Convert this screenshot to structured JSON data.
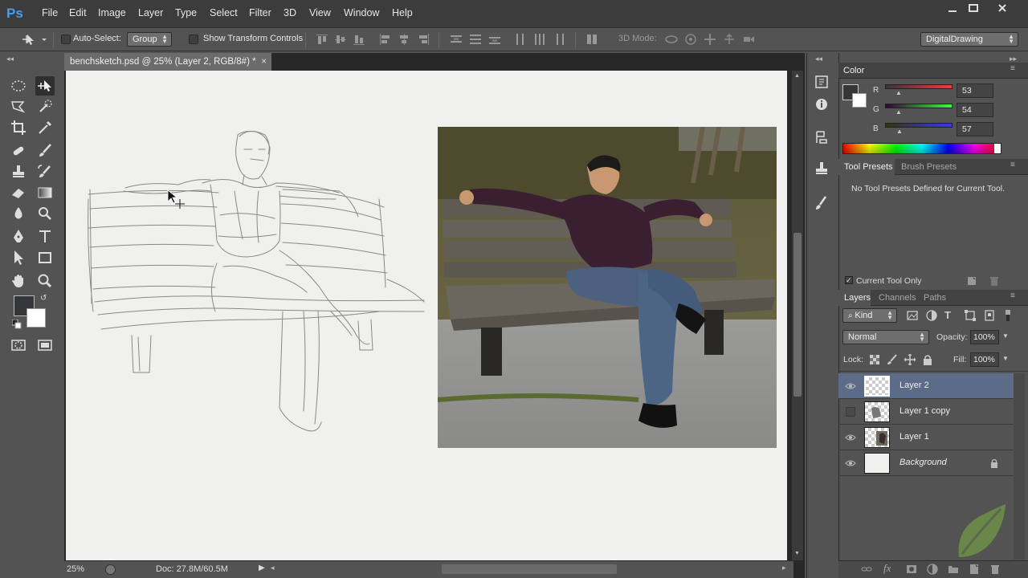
{
  "app": {
    "logo": "Ps"
  },
  "menu": [
    "File",
    "Edit",
    "Image",
    "Layer",
    "Type",
    "Select",
    "Filter",
    "3D",
    "View",
    "Window",
    "Help"
  ],
  "options": {
    "auto_select_label": "Auto-Select:",
    "auto_select_value": "Group",
    "show_transform_label": "Show Transform Controls",
    "mode3d_label": "3D Mode:",
    "workspace": "DigitalDrawing"
  },
  "document": {
    "tab_title": "benchsketch.psd @ 25% (Layer 2, RGB/8#) *",
    "tab_close": "×"
  },
  "status": {
    "zoom": "25%",
    "doc_size": "Doc: 27.8M/60.5M"
  },
  "color_panel": {
    "tab": "Color",
    "r_label": "R",
    "r_value": "53",
    "g_label": "G",
    "g_value": "54",
    "b_label": "B",
    "b_value": "57",
    "foreground_hex": "#353639"
  },
  "presets_panel": {
    "tab_tool_presets": "Tool Presets",
    "tab_brush_presets": "Brush Presets",
    "empty_message": "No Tool Presets Defined for Current Tool.",
    "current_tool_only": "Current Tool Only"
  },
  "layers_panel": {
    "tab_layers": "Layers",
    "tab_channels": "Channels",
    "tab_paths": "Paths",
    "kind_filter": "Kind",
    "blend_mode": "Normal",
    "opacity_label": "Opacity:",
    "opacity_value": "100%",
    "lock_label": "Lock:",
    "fill_label": "Fill:",
    "fill_value": "100%",
    "layers": [
      {
        "name": "Layer 2",
        "visible": true,
        "selected": true
      },
      {
        "name": "Layer 1 copy",
        "visible": false,
        "selected": false
      },
      {
        "name": "Layer 1",
        "visible": true,
        "selected": false
      },
      {
        "name": "Background",
        "visible": true,
        "selected": false,
        "locked": true
      }
    ]
  }
}
